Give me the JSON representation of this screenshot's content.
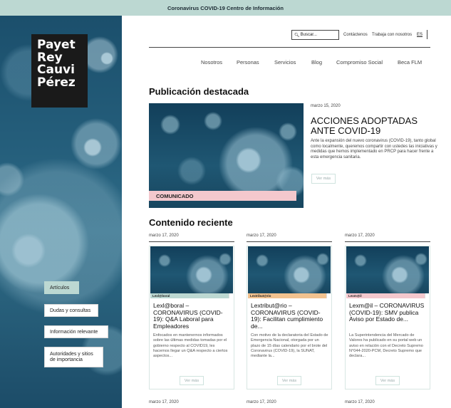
{
  "banner": {
    "text": "Coronavirus COVID-19 Centro de Información"
  },
  "logo": {
    "lines": [
      "Payet",
      "Rey",
      "Cauvi",
      "Pérez"
    ]
  },
  "sidebar": {
    "items": [
      {
        "label": "Artículos",
        "active": true
      },
      {
        "label": "Dudas y consultas"
      },
      {
        "label": "Información relevante"
      },
      {
        "label": "Autoridades y sitios de importancia"
      }
    ]
  },
  "header": {
    "search_label": "Buscar...",
    "links": [
      "Contáctenos",
      "Trabaja con nosotros"
    ],
    "lang": "ES"
  },
  "nav": {
    "items": [
      "Nosotros",
      "Personas",
      "Servicios",
      "Blog",
      "Compromiso Social",
      "Beca FLM"
    ]
  },
  "featured": {
    "section_title": "Publicación destacada",
    "label": "COMUNICADO",
    "date": "marzo 15, 2020",
    "title": "ACCIONES ADOPTADAS ANTE COVID-19",
    "excerpt": "Ante la expansión del nuevo coronavirus (COVID-19), tanto global como localmente, queremos compartir con ustedes las iniciativas y medidas que hemos implementado en PRCP para hacer frente a esta emergencia sanitaria.",
    "more_label": "Ver más"
  },
  "recent": {
    "section_title": "Contenido reciente",
    "cards": [
      {
        "date": "marzo 17, 2020",
        "tag": "Lexl@boral",
        "tag_color": "#bcd8d2",
        "title": "Lexl@boral – CORONAVIRUS (COVID-19): Q&A Laboral para Empleadores",
        "excerpt": "Enfocados en mantenernos informados sobre las últimas medidas tomadas por el gobierno respecto al COVID19, les hacemos llegar un Q&A respecto a ciertos aspectos...",
        "more_label": "Ver más"
      },
      {
        "date": "marzo 17, 2020",
        "tag": "Lextribut@rio",
        "tag_color": "#f2c28f",
        "title": "Lextribut@rio – CORONAVIRUS (COVID-19): Facilitan cumplimiento de...",
        "excerpt": "Con motivo de la declaratoria del Estado de Emergencia Nacional, otorgada por un plazo de 15 días calendario por el brote del Coronavirus (COVID-19), la SUNAT, mediante la...",
        "more_label": "Ver más"
      },
      {
        "date": "marzo 17, 2020",
        "tag": "Lexm@il",
        "tag_color": "#f4c8cd",
        "title": "Lexm@il – CORONAVIRUS (COVID-19): SMV publica Aviso por Estado de...",
        "excerpt": "La Superintendencia del Mercado de Valores ha publicado en su portal web un aviso en relación con el Decreto Supremo N°044-2020-PCM, Decreto Supremo que declara...",
        "more_label": "Ver más"
      }
    ],
    "next_dates": [
      "marzo 17, 2020",
      "marzo 17, 2020",
      "marzo 17, 2020"
    ]
  }
}
